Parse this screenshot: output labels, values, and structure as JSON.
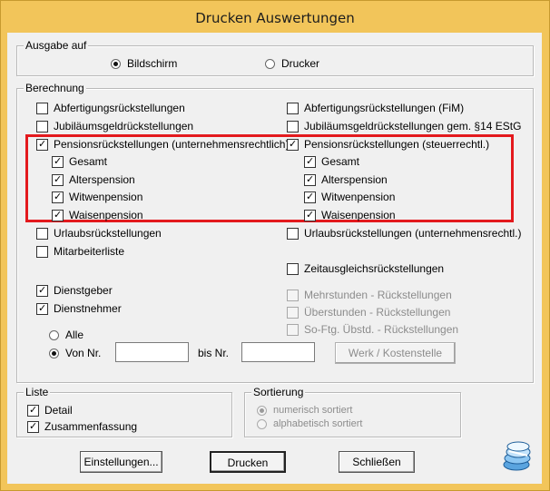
{
  "window": {
    "title": "Drucken Auswertungen"
  },
  "ausgabe": {
    "label": "Ausgabe auf",
    "bildschirm": "Bildschirm",
    "drucker": "Drucker",
    "selected": "Bildschirm"
  },
  "berechnung": {
    "label": "Berechnung",
    "left": [
      {
        "label": "Abfertigungsrückstellungen",
        "checked": false
      },
      {
        "label": "Jubiläumsgeldrückstellungen",
        "checked": false
      },
      {
        "label": "Pensionsrückstellungen (unternehmensrechtlich)",
        "checked": true
      },
      {
        "label": "Gesamt",
        "checked": true
      },
      {
        "label": "Alterspension",
        "checked": true
      },
      {
        "label": "Witwenpension",
        "checked": true
      },
      {
        "label": "Waisenpension",
        "checked": true
      },
      {
        "label": "Urlaubsrückstellungen",
        "checked": false
      },
      {
        "label": "Mitarbeiterliste",
        "checked": false
      },
      {
        "label": "Dienstgeber",
        "checked": true
      },
      {
        "label": "Dienstnehmer",
        "checked": true
      }
    ],
    "right": [
      {
        "label": "Abfertigungsrückstellungen (FiM)",
        "checked": false
      },
      {
        "label": "Jubiläumsgeldrückstellungen gem. §14 EStG",
        "checked": false
      },
      {
        "label": "Pensionsrückstellungen (steuerrechtl.)",
        "checked": true
      },
      {
        "label": "Gesamt",
        "checked": true
      },
      {
        "label": "Alterspension",
        "checked": true
      },
      {
        "label": "Witwenpension",
        "checked": true
      },
      {
        "label": "Waisenpension",
        "checked": true
      },
      {
        "label": "Urlaubsrückstellungen (unternehmensrechtl.)",
        "checked": false
      },
      {
        "label": "Zeitausgleichsrückstellungen",
        "checked": false
      },
      {
        "label": "Mehrstunden - Rückstellungen",
        "checked": false
      },
      {
        "label": "Überstunden - Rückstellungen",
        "checked": false
      },
      {
        "label": "So-Ftg. Übstd. - Rückstellungen",
        "checked": false
      }
    ],
    "range": {
      "alle": "Alle",
      "von_nr": "Von Nr.",
      "bis_nr": "bis  Nr.",
      "selected": "Von Nr.",
      "von_value": "",
      "bis_value": ""
    },
    "werk_button": "Werk / Kostenstelle"
  },
  "liste": {
    "label": "Liste",
    "detail": {
      "label": "Detail",
      "checked": true
    },
    "zusammenfassung": {
      "label": "Zusammenfassung",
      "checked": true
    }
  },
  "sortierung": {
    "label": "Sortierung",
    "numerisch": "numerisch sortiert",
    "alphabetisch": "alphabetisch sortiert",
    "selected": "numerisch sortiert"
  },
  "buttons": {
    "einstellungen": "Einstellungen...",
    "drucken": "Drucken",
    "schliessen": "Schließen"
  },
  "colors": {
    "frame": "#f2c55a",
    "client": "#f0f0f0",
    "highlight": "#e3191d"
  },
  "icons": {
    "corner_logo": "stacked-disks-icon"
  }
}
